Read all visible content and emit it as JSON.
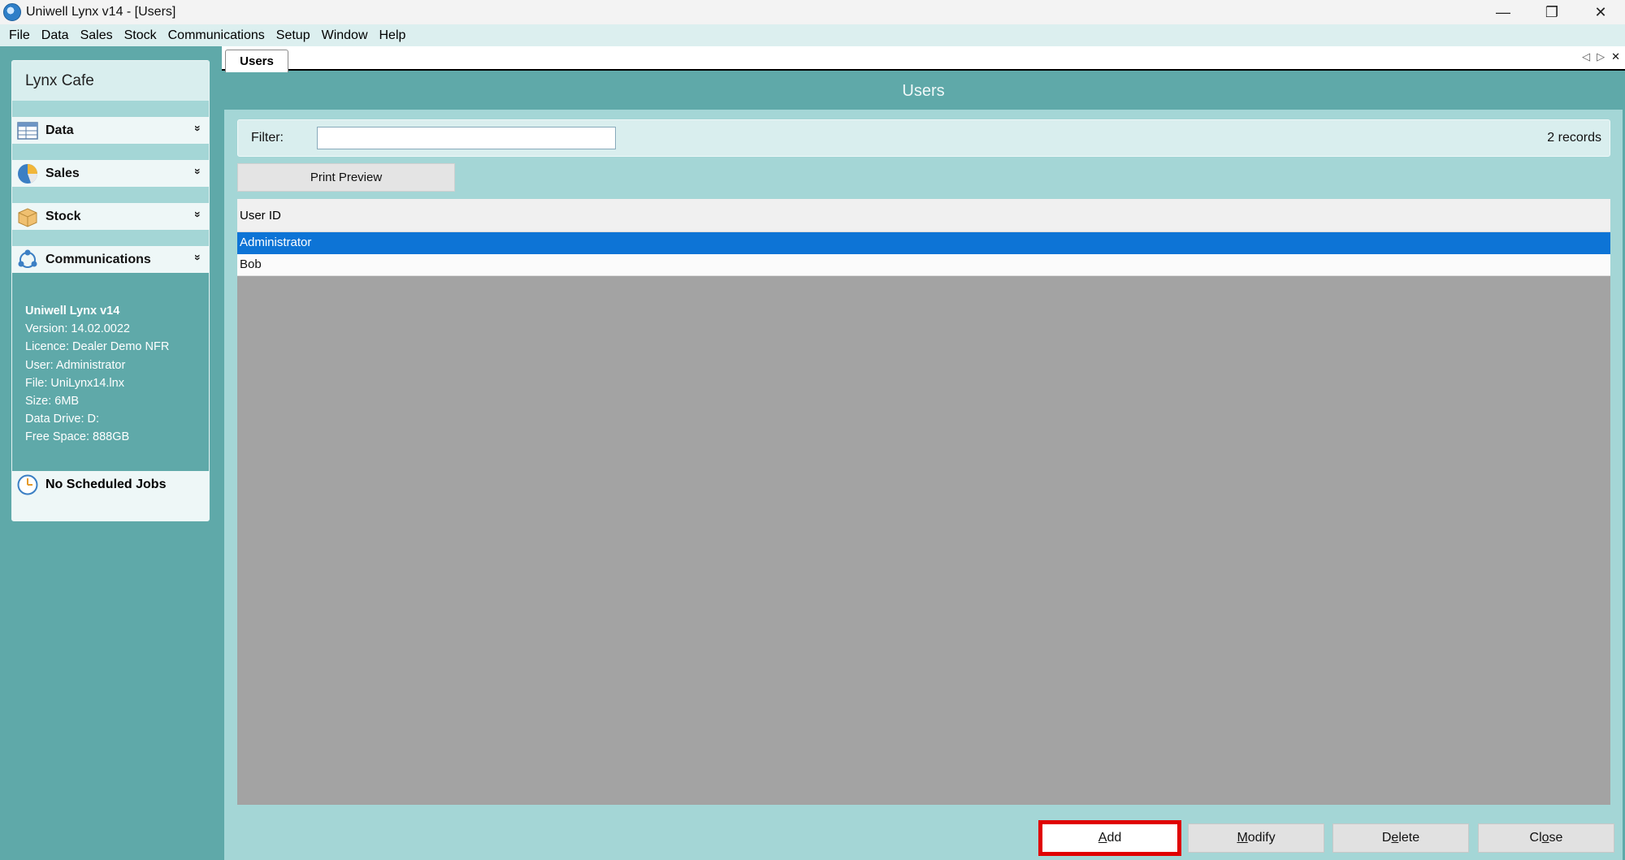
{
  "window": {
    "title": "Uniwell Lynx v14 - [Users]",
    "controls": {
      "minimize": "—",
      "restore": "❐",
      "close": "✕"
    }
  },
  "menubar": {
    "items": [
      "File",
      "Data",
      "Sales",
      "Stock",
      "Communications",
      "Setup",
      "Window",
      "Help"
    ]
  },
  "sidebar": {
    "company": "Lynx Cafe",
    "sections": [
      {
        "label": "Data",
        "icon": "data-table-icon"
      },
      {
        "label": "Sales",
        "icon": "pie-chart-icon"
      },
      {
        "label": "Stock",
        "icon": "box-icon"
      },
      {
        "label": "Communications",
        "icon": "network-icon"
      }
    ],
    "chevron": "»",
    "info": {
      "title": "Uniwell Lynx v14",
      "version": "Version: 14.02.0022",
      "licence": "Licence: Dealer Demo NFR",
      "user": "User: Administrator",
      "file": "File: UniLynx14.lnx",
      "size": "Size: 6MB",
      "data_drive": "Data Drive: D:",
      "free_space": "Free Space: 888GB"
    },
    "jobs": {
      "label": "No Scheduled Jobs",
      "icon": "clock-icon"
    }
  },
  "tabs": [
    {
      "label": "Users",
      "active": true
    }
  ],
  "tab_controls": {
    "prev": "◁",
    "next": "▷",
    "close": "✕"
  },
  "document": {
    "title": "Users",
    "filter": {
      "label": "Filter:",
      "value": "",
      "placeholder": ""
    },
    "records": "2 records",
    "print_preview": "Print Preview",
    "grid": {
      "columns": [
        "User ID"
      ],
      "rows": [
        {
          "user_id": "Administrator",
          "selected": true
        },
        {
          "user_id": "Bob",
          "selected": false
        }
      ]
    },
    "actions": {
      "add": {
        "accel": "A",
        "rest": "dd"
      },
      "modify": {
        "accel": "M",
        "rest": "odify"
      },
      "delete": {
        "pre": "D",
        "accel": "e",
        "rest": "lete"
      },
      "close": {
        "pre": "Cl",
        "accel": "o",
        "rest": "se"
      }
    }
  },
  "colors": {
    "teal": "#5fa9a9",
    "light_teal": "#a4d6d6",
    "selection": "#0d74d6",
    "highlight_red": "#e00000"
  }
}
